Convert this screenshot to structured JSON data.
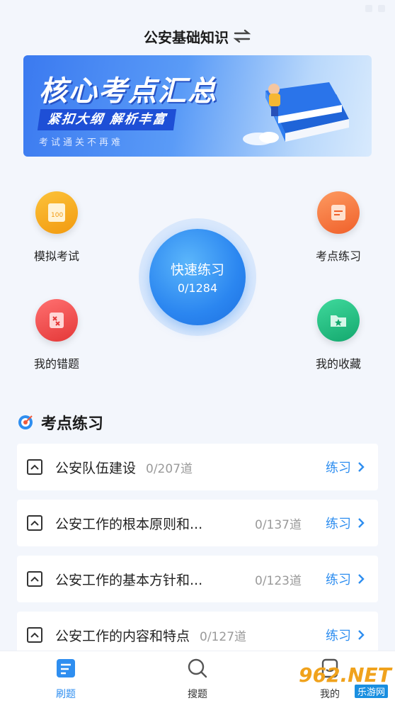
{
  "header": {
    "title": "公安基础知识",
    "switch_icon": "swap-icon"
  },
  "banner": {
    "title": "核心考点汇总",
    "subtitle": "紧扣大纲 解析丰富",
    "tagline": "考试通关不再难"
  },
  "grid": [
    {
      "label": "模拟考试",
      "icon": "exam-paper-icon",
      "color": "#f6a619"
    },
    {
      "label": "考点练习",
      "icon": "notebook-icon",
      "color": "#f7743b"
    },
    {
      "label": "我的错题",
      "icon": "wrong-answers-icon",
      "color": "#ee4a4a"
    },
    {
      "label": "我的收藏",
      "icon": "favorite-folder-icon",
      "color": "#1fbf83"
    }
  ],
  "quick": {
    "label": "快速练习",
    "count": "0/1284"
  },
  "section": {
    "title": "考点练习"
  },
  "chapters": [
    {
      "name": "公安队伍建设",
      "count": "0/207道",
      "action": "练习"
    },
    {
      "name": "公安工作的根本原则和...",
      "count": "0/137道",
      "action": "练习"
    },
    {
      "name": "公安工作的基本方针和...",
      "count": "0/123道",
      "action": "练习"
    },
    {
      "name": "公安工作的内容和特点",
      "count": "0/127道",
      "action": "练习"
    }
  ],
  "tabs": [
    {
      "label": "刷题",
      "active": true
    },
    {
      "label": "搜题",
      "active": false
    },
    {
      "label": "我的",
      "active": false
    }
  ],
  "watermark": {
    "brand": "962.NET",
    "site": "乐游网"
  },
  "colors": {
    "accent": "#2e8ef0",
    "background": "#f3f6fc"
  }
}
